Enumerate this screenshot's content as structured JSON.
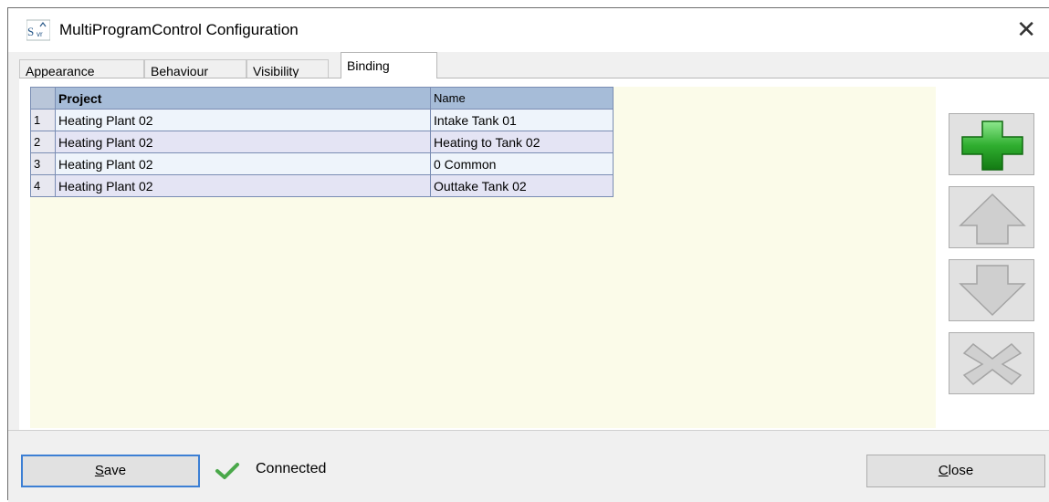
{
  "window": {
    "title": "MultiProgramControl Configuration",
    "icon": "svr-app-icon"
  },
  "tabs": [
    {
      "label": "Appearance",
      "active": false
    },
    {
      "label": "Behaviour",
      "active": false
    },
    {
      "label": "Visibility",
      "active": false
    },
    {
      "label": "Binding",
      "active": true
    }
  ],
  "grid": {
    "columns": [
      "Project",
      "Name"
    ],
    "rows": [
      {
        "num": "1",
        "project": "Heating Plant 02",
        "name": "Intake Tank 01"
      },
      {
        "num": "2",
        "project": "Heating Plant 02",
        "name": "Heating to Tank 02"
      },
      {
        "num": "3",
        "project": "Heating Plant 02",
        "name": "0 Common"
      },
      {
        "num": "4",
        "project": "Heating Plant 02",
        "name": "Outtake Tank 02"
      }
    ]
  },
  "side_buttons": [
    "add-icon",
    "arrow-up-icon",
    "arrow-down-icon",
    "delete-icon"
  ],
  "footer": {
    "save_first": "S",
    "save_rest": "ave",
    "status": "Connected",
    "close_first": "C",
    "close_rest": "lose"
  },
  "colors": {
    "accent": "#3c7fd4",
    "grid_header": "#a6bcd8",
    "grid_bg": "#fbfbe9",
    "add_green": "#2fae2f"
  }
}
